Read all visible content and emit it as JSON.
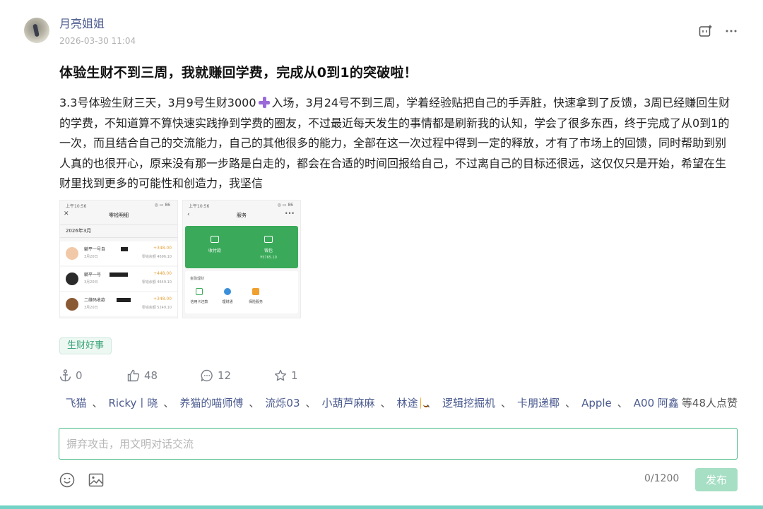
{
  "post": {
    "author": "月亮姐姐",
    "time": "2026-03-30 11:04",
    "title": "体验生财不到三周，我就赚回学费，完成从0到1的突破啦！",
    "body_part1": "3.3号体验生财三天，3月9号生财3000",
    "body_part2": "入场，3月24号不到三周，学着经验贴把自己的手弄脏，快速拿到了反馈，3周已经赚回生财的学费，不知道算不算快速实践挣到学费的圈友，不过最近每天发生的事情都是刷新我的认知，学会了很多东西，终于完成了从0到1的一次，而且结合自己的交流能力，自己的其他很多的能力，全部在这一次过程中得到一定的释放，才有了市场上的回馈，同时帮助到别人真的也很开心，原来没有那一步路是白走的，都会在合适的时间回报给自己，不过离自己的目标还很远，这仅仅只是开始，希望在生财里找到更多的可能性和创造力，我坚信",
    "tag": "生财好事"
  },
  "screenshot1": {
    "status_time": "上午10:56",
    "status_right": "◎ ▭ 86",
    "title": "零钱明细",
    "month": "2026年3月",
    "rows": [
      {
        "name": "躺平一号自",
        "sub": "3月20日",
        "amount": "+348.00",
        "balance": "零钱余额 4696.10"
      },
      {
        "name": "躺平一号",
        "sub": "3月20日",
        "amount": "+448.00",
        "balance": "零钱余额 4649.10"
      },
      {
        "name": "二维码收款",
        "sub": "3月20日",
        "amount": "+348.00",
        "balance": "零钱余额 5249.10"
      }
    ]
  },
  "screenshot2": {
    "status_time": "上午10:56",
    "status_right": "◎ ▭ 86",
    "title": "服务",
    "pay_label": "收付款",
    "wallet_label": "钱包",
    "wallet_value": "¥5765.10",
    "section_title": "金融理财",
    "items": [
      "信用卡还款",
      "理财通",
      "保险服务"
    ]
  },
  "actions": {
    "anchor_count": "0",
    "like_count": "48",
    "comment_count": "12",
    "star_count": "1"
  },
  "likers": {
    "names": [
      "飞猫",
      "Ricky丨晓",
      "养猫的喵师傅",
      "流烁03",
      "小葫芦麻麻",
      "林途",
      "逻辑挖掘机",
      "卡朋递椰",
      "Apple",
      "A00 阿鑫"
    ],
    "suffix": "等48人点赞"
  },
  "comment": {
    "placeholder": "摒弃攻击，用文明对话交流",
    "value": "",
    "counter": "0/1200",
    "publish_label": "发布"
  },
  "colors": {
    "accent_green": "#42b883",
    "link_blue": "#4a5a8f",
    "publish_disabled": "#a6dfc4",
    "like_orange": "#f08c1e"
  }
}
